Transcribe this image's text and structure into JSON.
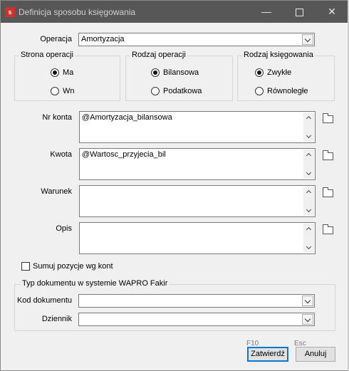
{
  "window": {
    "title": "Definicja sposobu księgowania",
    "app_icon_letter": "s",
    "minimize_glyph": "—",
    "close_glyph": "✕"
  },
  "operacja": {
    "label": "Operacja",
    "value": "Amortyzacja"
  },
  "strona": {
    "legend": "Strona operacji",
    "options": [
      {
        "label": "Ma",
        "selected": true
      },
      {
        "label": "Wn",
        "selected": false
      }
    ]
  },
  "rodzaj_operacji": {
    "legend": "Rodzaj operacji",
    "options": [
      {
        "label": "Bilansowa",
        "selected": true
      },
      {
        "label": "Podatkowa",
        "selected": false
      }
    ]
  },
  "rodzaj_ksiegowania": {
    "legend": "Rodzaj księgowania",
    "options": [
      {
        "label": "Zwykłe",
        "selected": true
      },
      {
        "label": "Równoległe",
        "selected": false
      }
    ]
  },
  "fields": {
    "nr_konta": {
      "label": "Nr konta",
      "value": "@Amortyzacja_bilansowa"
    },
    "kwota": {
      "label": "Kwota",
      "value": "@Wartosc_przyjecia_bil"
    },
    "warunek": {
      "label": "Warunek",
      "value": ""
    },
    "opis": {
      "label": "Opis",
      "value": ""
    }
  },
  "sumuj": {
    "label": "Sumuj pozycje wg kont",
    "checked": false
  },
  "typ_dokumentu": {
    "legend": "Typ dokumentu w systemie WAPRO Fakir",
    "kod_label": "Kod dokumentu",
    "kod_value": "",
    "dziennik_label": "Dziennik",
    "dziennik_value": ""
  },
  "buttons": {
    "zatwierdz": {
      "label": "Zatwierdź",
      "hint": "F10"
    },
    "anuluj": {
      "label": "Anuluj",
      "hint": "Esc"
    }
  },
  "colors": {
    "titlebar": "#575757",
    "accent": "#0078d7",
    "app_icon": "#d32f2f"
  }
}
